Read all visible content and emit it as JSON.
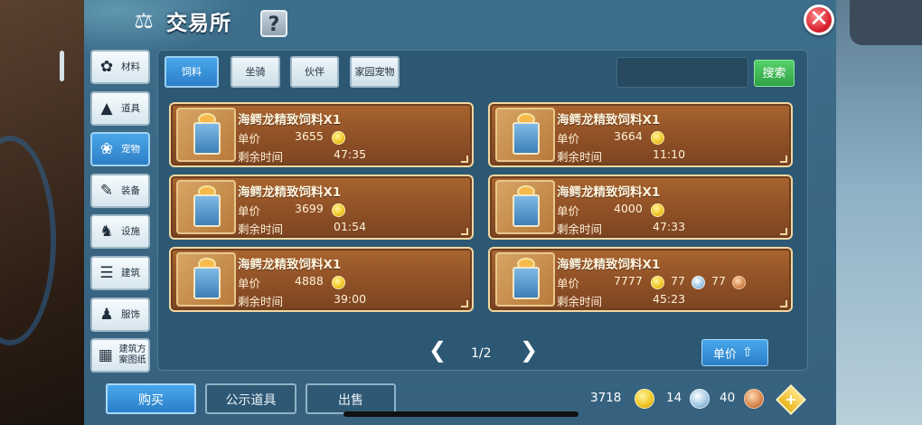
{
  "header": {
    "title": "交易所",
    "help_label": "?",
    "close_label": "✕"
  },
  "sidebar": {
    "items": [
      {
        "label": "材料",
        "icon": "material-icon",
        "glyph": "✿"
      },
      {
        "label": "道具",
        "icon": "prop-icon",
        "glyph": "▲"
      },
      {
        "label": "宠物",
        "icon": "paw-icon",
        "glyph": "❀"
      },
      {
        "label": "装备",
        "icon": "equipment-icon",
        "glyph": "✎"
      },
      {
        "label": "设施",
        "icon": "facility-icon",
        "glyph": "♞"
      },
      {
        "label": "建筑",
        "icon": "building-icon",
        "glyph": "☰"
      },
      {
        "label": "服饰",
        "icon": "clothing-icon",
        "glyph": "♟"
      },
      {
        "label": "建筑方案图纸",
        "icon": "blueprint-icon",
        "glyph": "▦"
      }
    ],
    "active_index": 2
  },
  "tabs": [
    {
      "label": "饲料"
    },
    {
      "label": "坐骑"
    },
    {
      "label": "伙伴"
    },
    {
      "label": "家园宠物"
    }
  ],
  "search": {
    "button_label": "搜索",
    "placeholder": ""
  },
  "listing_labels": {
    "price": "单价",
    "time": "剩余时间"
  },
  "listings": [
    {
      "name": "海鳄龙精致饲料X1",
      "price": "3655",
      "time": "47:35"
    },
    {
      "name": "海鳄龙精致饲料X1",
      "price": "3664",
      "time": "11:10"
    },
    {
      "name": "海鳄龙精致饲料X1",
      "price": "3699",
      "time": "01:54"
    },
    {
      "name": "海鳄龙精致饲料X1",
      "price": "4000",
      "time": "47:33"
    },
    {
      "name": "海鳄龙精致饲料X1",
      "price": "4888",
      "time": "39:00"
    },
    {
      "name": "海鳄龙精致饲料X1",
      "price": "7777",
      "silver": "77",
      "copper": "77",
      "time": "45:23"
    }
  ],
  "pager": {
    "text": "1/2",
    "prev": "❮",
    "next": "❯"
  },
  "sort": {
    "label": "单价",
    "arrow": "⇧"
  },
  "bottom": {
    "buy": "购买",
    "public": "公示道具",
    "sell": "出售"
  },
  "wallet": {
    "gold": "3718",
    "silver": "14",
    "copper": "40",
    "plus": "+"
  },
  "colors": {
    "accent": "#2a7ec8",
    "card": "#915227",
    "search": "#2ea244",
    "close": "#d8202e"
  }
}
